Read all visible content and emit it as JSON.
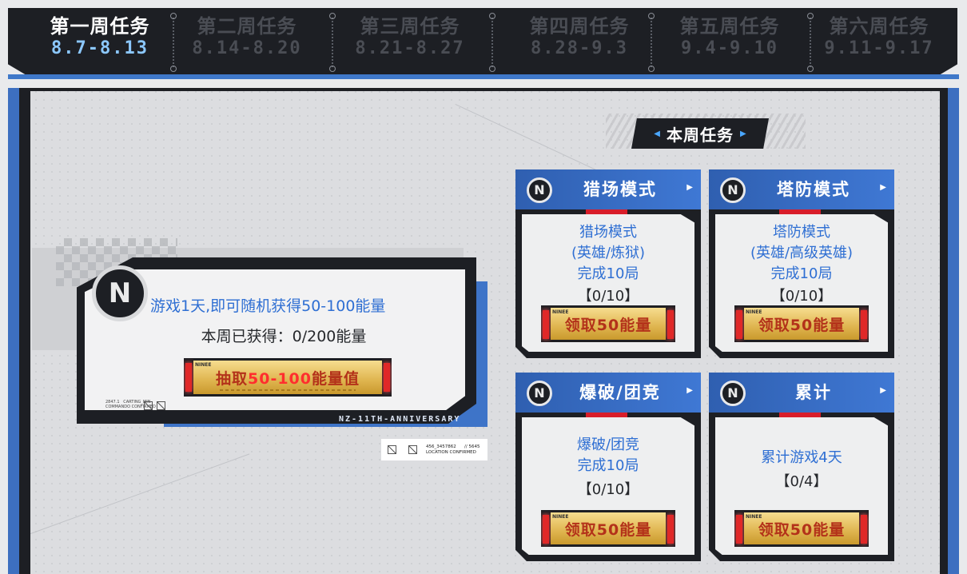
{
  "tabs": [
    {
      "title": "第一周任务",
      "dates": "8.7-8.13",
      "active": true
    },
    {
      "title": "第二周任务",
      "dates": "8.14-8.20",
      "active": false
    },
    {
      "title": "第三周任务",
      "dates": "8.21-8.27",
      "active": false
    },
    {
      "title": "第四周任务",
      "dates": "8.28-9.3",
      "active": false
    },
    {
      "title": "第五周任务",
      "dates": "9.4-9.10",
      "active": false
    },
    {
      "title": "第六周任务",
      "dates": "9.11-9.17",
      "active": false
    }
  ],
  "daily": {
    "description": "游戏1天,即可随机获得50-100能量",
    "progress": "本周已获得：0/200能量",
    "button_prefix": "抽取",
    "button_highlight": "50-100",
    "button_suffix": "能量值",
    "footer": "NZ-11TH-ANNIVERSARY",
    "tiny_tag": "2847.1   CARTING_MIN\nCOMMANDO CONFIRMED",
    "logo_letter": "N"
  },
  "location_tag": {
    "code": "456_3457862",
    "index": "// 5645",
    "status": "LOCATION CONFIRMED"
  },
  "weekly_header": "本周任务",
  "cards": [
    {
      "header": "猎场模式",
      "desc": [
        "猎场模式",
        "(英雄/炼狱)",
        "完成10局"
      ],
      "count": "【0/10】",
      "button": "领取50能量"
    },
    {
      "header": "塔防模式",
      "desc": [
        "塔防模式",
        "(英雄/高级英雄)",
        "完成10局"
      ],
      "count": "【0/10】",
      "button": "领取50能量"
    },
    {
      "header": "爆破/团竞",
      "desc": [
        "爆破/团竞",
        "完成10局"
      ],
      "count": "【0/10】",
      "button": "领取50能量"
    },
    {
      "header": "累计",
      "desc": [
        "累计游戏4天"
      ],
      "count": "【0/4】",
      "button": "领取50能量"
    }
  ],
  "button_brand": "NINEE",
  "colors": {
    "accent_blue": "#3d6fc0",
    "active_date": "#8cc8ff",
    "link_text": "#2f6fd3",
    "gold": "#dfb44e",
    "red": "#e02828"
  }
}
